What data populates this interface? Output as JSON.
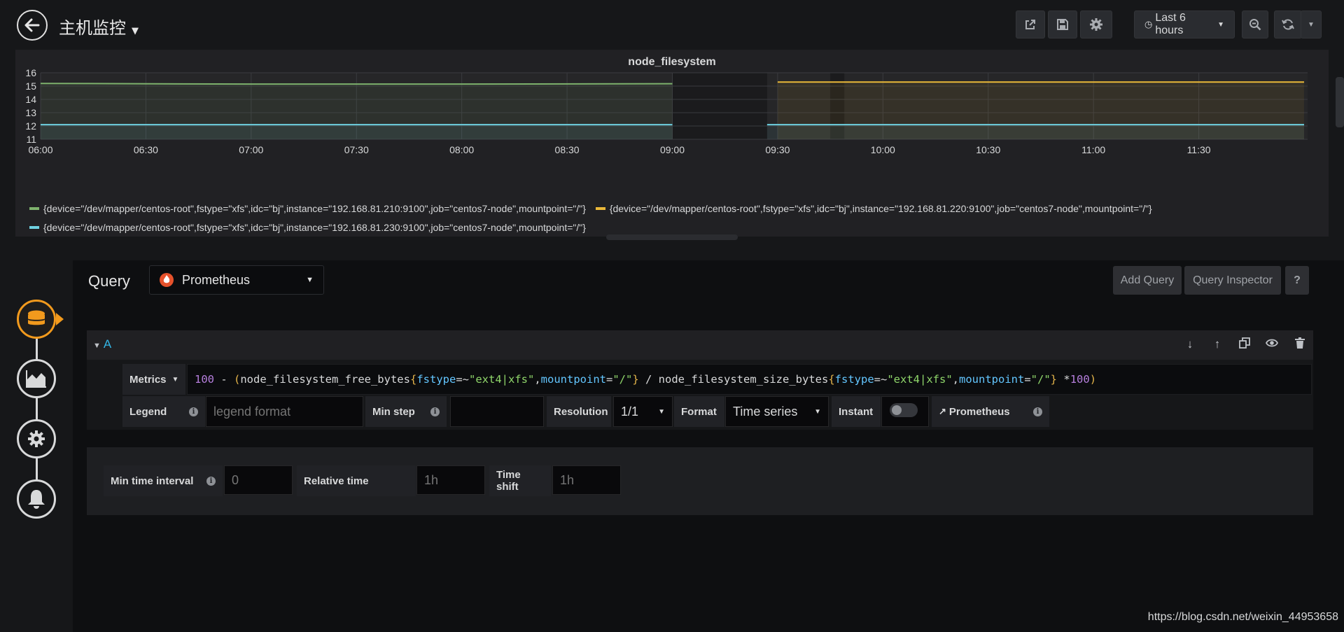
{
  "header": {
    "title": "主机监控",
    "time_range": "Last 6 hours"
  },
  "panel": {
    "title": "node_filesystem"
  },
  "chart_data": {
    "type": "line",
    "title": "node_filesystem",
    "x_ticks": [
      "06:00",
      "06:30",
      "07:00",
      "07:30",
      "08:00",
      "08:30",
      "09:00",
      "09:30",
      "10:00",
      "10:30",
      "11:00",
      "11:30"
    ],
    "y_ticks": [
      11,
      12,
      13,
      14,
      15,
      16
    ],
    "ylim": [
      11,
      16
    ],
    "xlim": [
      "06:00",
      "12:01"
    ],
    "grid": true,
    "legend_position": "bottom",
    "series": [
      {
        "name": "{device=\"/dev/mapper/centos-root\",fstype=\"xfs\",idc=\"bj\",instance=\"192.168.81.210:9100\",job=\"centos7-node\",mountpoint=\"/\"}",
        "color": "#7eb26d",
        "x": [
          "06:00",
          "07:00",
          "08:00",
          "09:00"
        ],
        "y": [
          15.2,
          15.15,
          15.15,
          15.18
        ]
      },
      {
        "name": "{device=\"/dev/mapper/centos-root\",fstype=\"xfs\",idc=\"bj\",instance=\"192.168.81.220:9100\",job=\"centos7-node\",mountpoint=\"/\"}",
        "color": "#eab839",
        "x": [
          "09:30",
          "09:45",
          "09:50",
          "10:00",
          "11:00",
          "12:00"
        ],
        "y": [
          15.3,
          15.3,
          15.3,
          15.3,
          15.3,
          15.3
        ]
      },
      {
        "name": "{device=\"/dev/mapper/centos-root\",fstype=\"xfs\",idc=\"bj\",instance=\"192.168.81.230:9100\",job=\"centos7-node\",mountpoint=\"/\"}",
        "color": "#6ed0e0",
        "x": [
          "06:00",
          "07:00",
          "08:00",
          "09:00"
        ],
        "y": [
          12.1,
          12.1,
          12.1,
          12.1
        ]
      },
      {
        "name": "",
        "color": "#6ed0e0",
        "x": [
          "09:27",
          "10:00",
          "11:00",
          "12:00"
        ],
        "y": [
          12.1,
          12.1,
          12.1,
          12.1
        ]
      }
    ]
  },
  "query_editor": {
    "title": "Query",
    "datasource": "Prometheus",
    "add_query": "Add Query",
    "query_inspector": "Query Inspector",
    "help": "?",
    "ref_id": "A",
    "metrics_label": "Metrics",
    "expr": {
      "p1": "100",
      "p2": " - ",
      "p3": "(",
      "p4": "node_filesystem_free_bytes",
      "p5": "{",
      "p6": "fstype",
      "p7": "=~",
      "p8": "\"ext4|xfs\"",
      "p9": ",",
      "p10": "mountpoint",
      "p11": "=",
      "p12": "\"/\"",
      "p13": "}",
      "p14": " / node_filesystem_size_bytes",
      "p15": "{",
      "p16": "fstype",
      "p17": "=~",
      "p18": "\"ext4|xfs\"",
      "p19": ",",
      "p20": "mountpoint",
      "p21": "=",
      "p22": "\"/\"",
      "p23": "}",
      "p24": " *",
      "p25": "100",
      "p26": ")"
    },
    "legend_label": "Legend",
    "legend_placeholder": "legend format",
    "min_step_label": "Min step",
    "resolution_label": "Resolution",
    "resolution_value": "1/1",
    "format_label": "Format",
    "format_value": "Time series",
    "instant_label": "Instant",
    "prometheus_link": "Prometheus"
  },
  "options": {
    "min_time_interval_label": "Min time interval",
    "min_time_interval_placeholder": "0",
    "relative_time_label": "Relative time",
    "relative_time_placeholder": "1h",
    "time_shift_label": "Time shift",
    "time_shift_placeholder": "1h"
  },
  "watermark": "https://blog.csdn.net/weixin_44953658"
}
